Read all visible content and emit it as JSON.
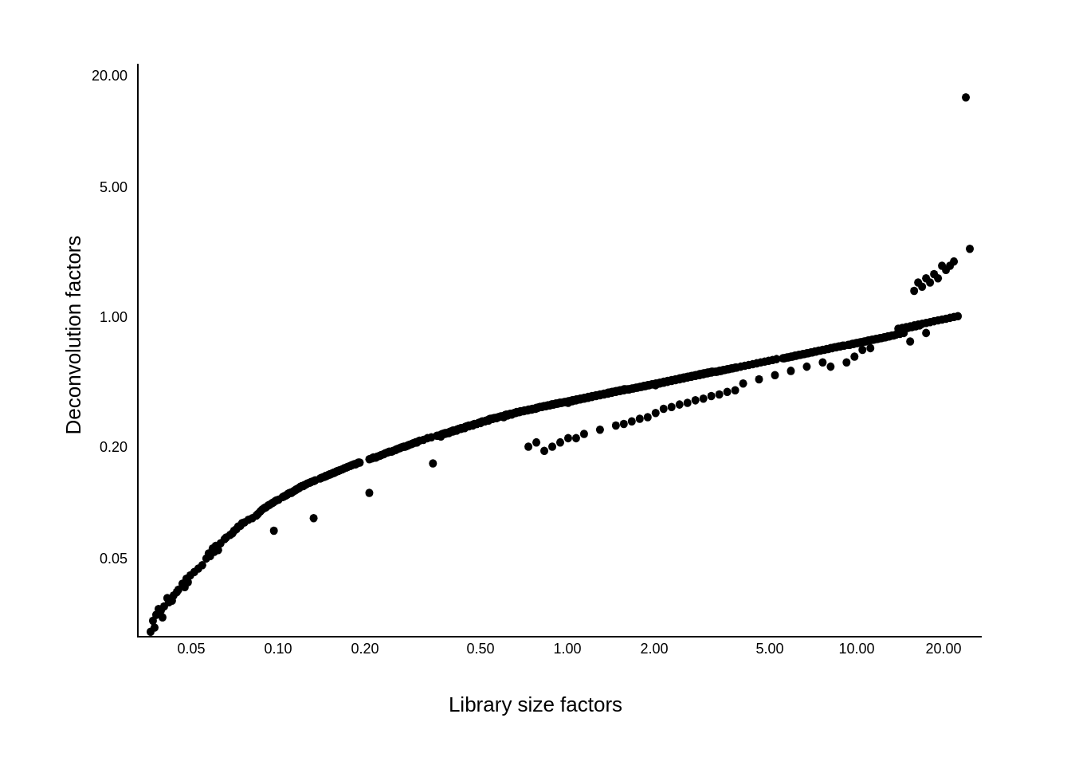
{
  "chart": {
    "title": "",
    "x_axis_label": "Library size factors",
    "y_axis_label": "Deconvolution factors",
    "x_ticks": [
      "0.05",
      "0.10",
      "0.20",
      "0.50",
      "1.00",
      "2.00",
      "5.00",
      "10.00",
      "20.00"
    ],
    "y_ticks": [
      "0.05",
      "0.20",
      "1.00",
      "5.00",
      "20.00"
    ],
    "background": "#ffffff",
    "dot_color": "#000000"
  }
}
